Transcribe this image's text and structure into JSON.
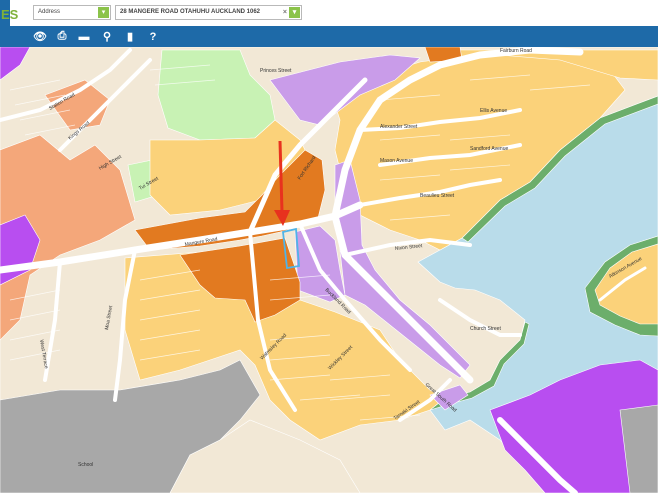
{
  "header": {
    "logo_text": "ES",
    "search_type": {
      "value": "Address"
    },
    "search_box": {
      "value": "28 MANGERE ROAD OTAHUHU AUCKLAND 1062"
    }
  },
  "toolbar": {
    "tools": [
      {
        "name": "view-icon",
        "glyph": "👁"
      },
      {
        "name": "print-icon",
        "glyph": "⎙"
      },
      {
        "name": "measure-icon",
        "glyph": "▬"
      },
      {
        "name": "location-pin-icon",
        "glyph": "⚲"
      },
      {
        "name": "bookmark-icon",
        "glyph": "▮"
      },
      {
        "name": "help-icon",
        "glyph": "?"
      }
    ]
  },
  "map": {
    "colors": {
      "water": "#b9dcea",
      "residential_mixed": "#fbd27a",
      "terrace_apartment": "#f4a77a",
      "town_centre": "#e27a20",
      "business": "#c99ce9",
      "light_industry": "#b84ef0",
      "open_space": "#c8f2b4",
      "coastal": "#6cae6b",
      "single_house": "#f2e8d6",
      "special": "#a8a8a8",
      "parcel_line": "#ffffff",
      "selected_parcel": "#4fb4e8",
      "marker": "#e8321e"
    },
    "street_labels": {
      "mangere_road": "Mangere Road",
      "nixon_street": "Nixon Street",
      "fort_richard": "Fort Richard",
      "great_south": "Great South Road",
      "kings_road": "Kings Road",
      "alexander": "Alexander Street",
      "mason": "Mason Avenue",
      "beaulieu": "Beaulieu Street",
      "princes": "Princes Street",
      "buckland": "Buckland Road",
      "church": "Church Street",
      "sandford": "Sandford Avenue",
      "ellis": "Ellis Avenue",
      "walmsley": "Walmsley Road",
      "wickley": "Wickley Street",
      "school": "School",
      "west_terrace": "West Terrace",
      "moa": "Moa Street",
      "fairburn": "Fairburn Road",
      "tui": "Tui Street",
      "high": "High Street",
      "station": "Station Road",
      "atkinson": "Atkinson Avenue",
      "tamaki": "Tamaki Street"
    }
  }
}
